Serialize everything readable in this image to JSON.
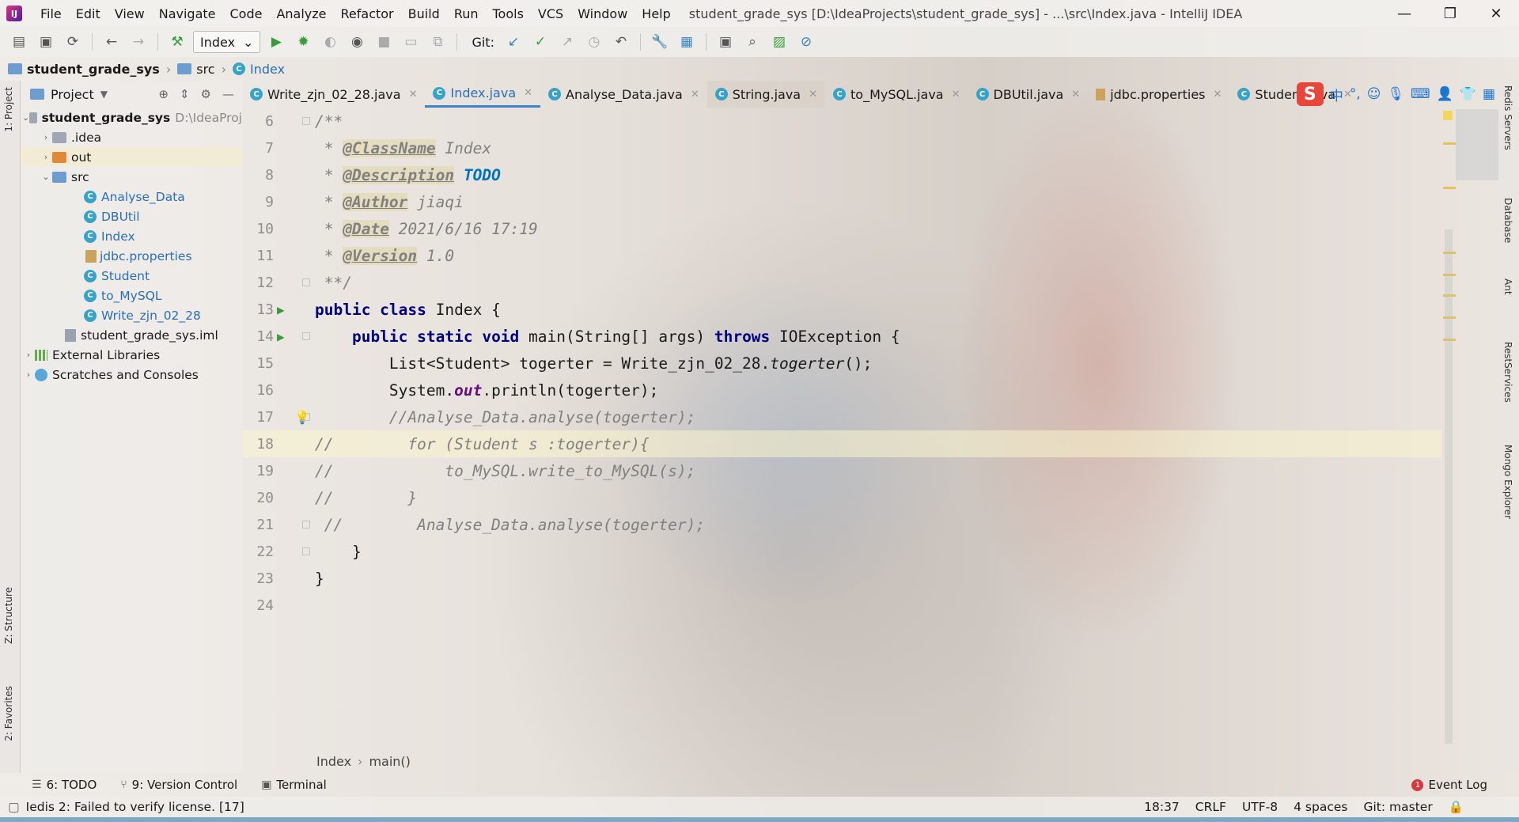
{
  "window": {
    "title": "student_grade_sys [D:\\IdeaProjects\\student_grade_sys] - ...\\src\\Index.java - IntelliJ IDEA",
    "minimize": "—",
    "restore": "❐",
    "close": "✕"
  },
  "menu": [
    "File",
    "Edit",
    "View",
    "Navigate",
    "Code",
    "Analyze",
    "Refactor",
    "Build",
    "Run",
    "Tools",
    "VCS",
    "Window",
    "Help"
  ],
  "toolbar": {
    "run_config": "Index",
    "git_label": "Git:"
  },
  "breadcrumb": {
    "project": "student_grade_sys",
    "folder": "src",
    "file": "Index"
  },
  "project_panel": {
    "title": "Project",
    "root": "student_grade_sys",
    "root_path": "D:\\IdeaProj",
    "items": [
      {
        "label": ".idea"
      },
      {
        "label": "out"
      },
      {
        "label": "src"
      },
      {
        "label": "Analyse_Data"
      },
      {
        "label": "DBUtil"
      },
      {
        "label": "Index"
      },
      {
        "label": "jdbc.properties"
      },
      {
        "label": "Student"
      },
      {
        "label": "to_MySQL"
      },
      {
        "label": "Write_zjn_02_28"
      },
      {
        "label": "student_grade_sys.iml"
      },
      {
        "label": "External Libraries"
      },
      {
        "label": "Scratches and Consoles"
      }
    ]
  },
  "tabs": [
    {
      "label": "Write_zjn_02_28.java"
    },
    {
      "label": "Index.java"
    },
    {
      "label": "Analyse_Data.java"
    },
    {
      "label": "String.java"
    },
    {
      "label": "to_MySQL.java"
    },
    {
      "label": "DBUtil.java"
    },
    {
      "label": "jdbc.properties"
    },
    {
      "label": "Student.java"
    }
  ],
  "tray": {
    "s": "S",
    "zh": "中"
  },
  "editor": {
    "line_numbers": [
      "6",
      "7",
      "8",
      "9",
      "10",
      "11",
      "12",
      "13",
      "14",
      "15",
      "16",
      "17",
      "18",
      "19",
      "20",
      "21",
      "22",
      "23",
      "24"
    ],
    "code": {
      "l6": "/**",
      "l7_star": " * ",
      "l7_tag": "@ClassName",
      "l7_val": " Index",
      "l8_star": " * ",
      "l8_tag": "@Description",
      "l8_val": " TODO",
      "l9_star": " * ",
      "l9_tag": "@Author",
      "l9_val": " jiaqi",
      "l10_star": " * ",
      "l10_tag": "@Date",
      "l10_val": " 2021/6/16 17:19",
      "l11_star": " * ",
      "l11_tag": "@Version",
      "l11_val": " 1.0",
      "l12": " **/",
      "l13_kw": "public class",
      "l13_rest": " Index {",
      "l14_indent": "    ",
      "l14_kw": "public static void",
      "l14_mid": " main(String[] args) ",
      "l14_kw2": "throws",
      "l14_rest": " IOException {",
      "l15_a": "        List<Student> togerter = Write_zjn_02_28.",
      "l15_m": "togerter",
      "l15_b": "();",
      "l16_a": "        System.",
      "l16_s": "out",
      "l16_b": ".println(togerter);",
      "l17": "        //Analyse_Data.analyse(togerter);",
      "l18": "//        for (Student s :togerter){",
      "l19": "//            to_MySQL.write_to_MySQL(s);",
      "l20": "//        }",
      "l21": " //        Analyse_Data.analyse(togerter);",
      "l22": "    }",
      "l23": "}",
      "l24": ""
    }
  },
  "editor_crumbs": {
    "class": "Index",
    "method": "main()"
  },
  "left_stripe": {
    "project": "1: Project",
    "structure": "Z: Structure",
    "favorites": "2: Favorites"
  },
  "right_stripe": [
    "Redis Servers",
    "Database",
    "Ant",
    "RestServices",
    "Mongo Explorer"
  ],
  "tool_windows": {
    "todo": "6: TODO",
    "vcs": "9: Version Control",
    "terminal": "Terminal",
    "event_log": "Event Log",
    "event_count": "1"
  },
  "status": {
    "message": "Iedis 2: Failed to verify license. [17]",
    "position": "18:37",
    "line_sep": "CRLF",
    "encoding": "UTF-8",
    "indent": "4 spaces",
    "git": "Git: master"
  },
  "colors": {
    "keyword": "#000080",
    "comment": "#808080",
    "todo": "#0073bf",
    "static_field": "#660e7a",
    "run_green": "#389a3a",
    "active_tab": "#4083c9"
  }
}
